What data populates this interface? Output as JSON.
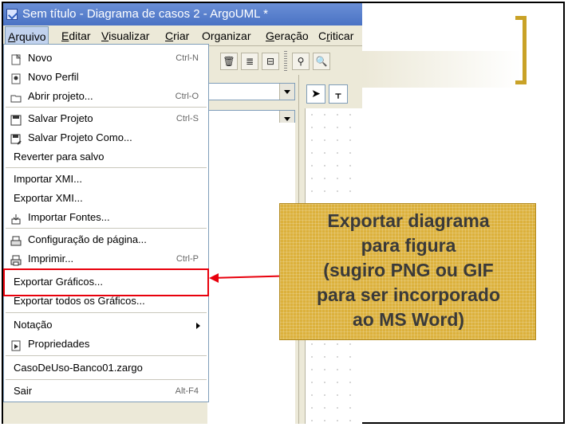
{
  "window": {
    "title": "Sem título - Diagrama de casos 2 - ArgoUML *"
  },
  "menubar": [
    {
      "label": "Arquivo",
      "mnemonic": "A",
      "rest": "rquivo",
      "active": true
    },
    {
      "label": "Editar",
      "mnemonic": "E",
      "rest": "ditar"
    },
    {
      "label": "Visualizar",
      "mnemonic": "V",
      "rest": "isualizar"
    },
    {
      "label": "Criar",
      "mnemonic": "C",
      "rest": "riar"
    },
    {
      "label": "Organizar",
      "pre": "Or",
      "mnemonic": "g",
      "rest": "anizar"
    },
    {
      "label": "Geração",
      "mnemonic": "G",
      "rest": "eração"
    },
    {
      "label": "Criticar",
      "pre": "C",
      "mnemonic": "r",
      "rest": "iticar"
    }
  ],
  "file_menu": {
    "items": [
      {
        "label": "Novo",
        "shortcut": "Ctrl-N",
        "icon": "new-file-icon"
      },
      {
        "label": "Novo Perfil",
        "shortcut": "",
        "icon": "new-profile-icon"
      },
      {
        "label": "Abrir projeto...",
        "shortcut": "Ctrl-O",
        "icon": "open-folder-icon"
      },
      {
        "label": "Salvar Projeto",
        "shortcut": "Ctrl-S",
        "icon": "save-icon"
      },
      {
        "label": "Salvar Projeto Como...",
        "shortcut": "",
        "icon": "save-as-icon"
      },
      {
        "label": "Reverter para salvo",
        "shortcut": "",
        "icon": ""
      },
      {
        "label": "Importar XMI...",
        "shortcut": "",
        "icon": ""
      },
      {
        "label": "Exportar XMI...",
        "shortcut": "",
        "icon": ""
      },
      {
        "label": "Importar Fontes...",
        "shortcut": "",
        "icon": "import-sources-icon"
      },
      {
        "label": "Configuração de página...",
        "shortcut": "",
        "icon": "page-setup-icon"
      },
      {
        "label": "Imprimir...",
        "shortcut": "Ctrl-P",
        "icon": "print-icon"
      },
      {
        "label": "Exportar Gráficos...",
        "shortcut": "",
        "icon": "",
        "highlighted": true
      },
      {
        "label": "Exportar todos os Gráficos...",
        "shortcut": "",
        "icon": ""
      },
      {
        "label": "Notação",
        "shortcut": "",
        "icon": "",
        "submenu": true
      },
      {
        "label": "Propriedades",
        "shortcut": "",
        "icon": "properties-icon"
      },
      {
        "label": "CasoDeUso-Banco01.zargo",
        "shortcut": "",
        "icon": ""
      },
      {
        "label": "Sair",
        "shortcut": "Alt-F4",
        "icon": ""
      }
    ]
  },
  "callout": {
    "lines": [
      "Exportar diagrama",
      "para figura",
      "(sugiro PNG ou GIF",
      "para ser incorporado",
      "ao MS Word)"
    ]
  },
  "colors": {
    "highlight_box": "#e8000c",
    "callout_fill": "#dcb13c",
    "bracket": "#c9a227",
    "title_bar": "#4a72c4"
  }
}
